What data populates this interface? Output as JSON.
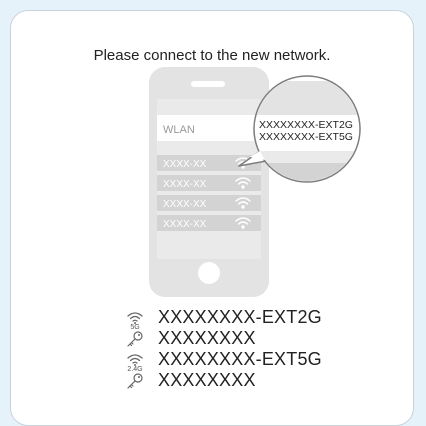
{
  "prompt": "Please connect to the new network.",
  "phone": {
    "wlan_label": "WLAN",
    "networks": [
      "XXXX-XX",
      "XXXX-XX",
      "XXXX-XX",
      "XXXX-XX"
    ]
  },
  "bubble": {
    "line1": "XXXXXXXX-EXT2G",
    "line2": "XXXXXXXX-EXT5G"
  },
  "info": [
    {
      "icon": "wifi-icon",
      "band": "5G",
      "text": "XXXXXXXX-EXT2G"
    },
    {
      "icon": "key-icon",
      "text": "XXXXXXXX"
    },
    {
      "icon": "wifi-icon",
      "band": "2.4G",
      "text": "XXXXXXXX-EXT5G"
    },
    {
      "icon": "key-icon",
      "text": "XXXXXXXX"
    }
  ],
  "colors": {
    "background": "#e6f2fa",
    "phone": "#e3e3e3",
    "phone_row": "#d3d3d3",
    "text_gray": "#9a9a9a"
  }
}
